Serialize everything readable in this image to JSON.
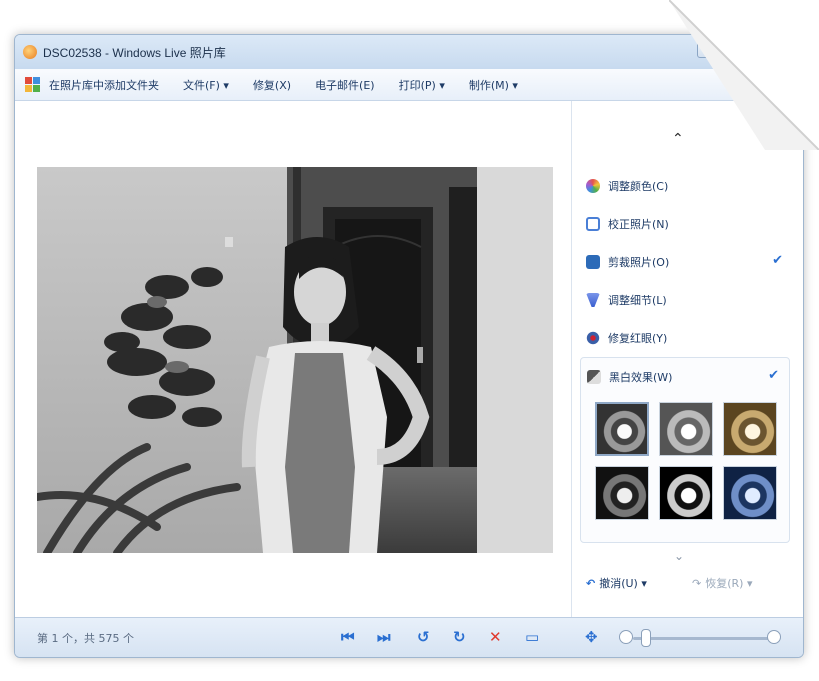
{
  "window": {
    "title": "DSC02538 - Windows Live 照片库"
  },
  "menubar": {
    "items": [
      {
        "label": "在照片库中添加文件夹",
        "name": "menu-add-to-gallery"
      },
      {
        "label": "文件(F) ▾",
        "name": "menu-file"
      },
      {
        "label": "修复(X)",
        "name": "menu-fix"
      },
      {
        "label": "电子邮件(E)",
        "name": "menu-email"
      },
      {
        "label": "打印(P) ▾",
        "name": "menu-print"
      },
      {
        "label": "制作(M) ▾",
        "name": "menu-make"
      }
    ]
  },
  "side": {
    "items": [
      {
        "label": "调整颜色(C)",
        "icon": "color-icon",
        "color": "#e4554f"
      },
      {
        "label": "校正照片(N)",
        "icon": "straighten-icon",
        "color": "#4a7fd6"
      },
      {
        "label": "剪裁照片(O)",
        "icon": "crop-icon",
        "color": "#2d6bb8"
      },
      {
        "label": "调整细节(L)",
        "icon": "detail-icon",
        "color": "#3a5fd0"
      },
      {
        "label": "修复红眼(Y)",
        "icon": "redeye-icon",
        "color": "#3a5fa8"
      }
    ],
    "bw_effects": {
      "label": "黑白效果(W)"
    },
    "undo_label": "撤消(U) ▾",
    "redo_label": "恢复(R) ▾",
    "close": "×",
    "chevron_up": "⌃",
    "chevron_down": "⌄"
  },
  "status": {
    "text": "第 1 个，共 575 个"
  },
  "controls": {
    "colors": {
      "nav": "#2a6fd1",
      "delete": "#e03a2e"
    }
  }
}
